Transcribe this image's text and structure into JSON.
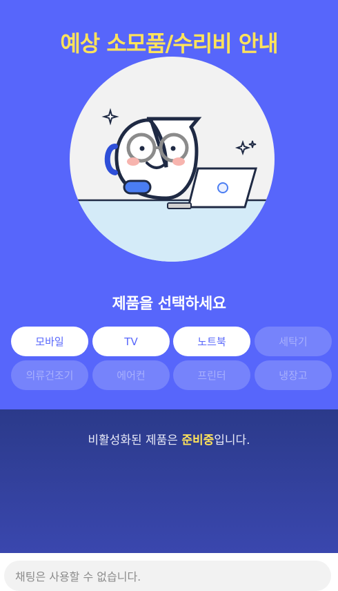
{
  "header": {
    "title": "예상 소모품/수리비 안내"
  },
  "main": {
    "subtitle": "제품을 선택하세요",
    "products": [
      {
        "label": "모바일",
        "enabled": true
      },
      {
        "label": "TV",
        "enabled": true
      },
      {
        "label": "노트북",
        "enabled": true
      },
      {
        "label": "세탁기",
        "enabled": false
      },
      {
        "label": "의류건조기",
        "enabled": false
      },
      {
        "label": "에어컨",
        "enabled": false
      },
      {
        "label": "프린터",
        "enabled": false
      },
      {
        "label": "냉장고",
        "enabled": false
      }
    ]
  },
  "notice": {
    "prefix": "비활성화된 제품은 ",
    "highlight": "준비중",
    "suffix": "입니다."
  },
  "chat": {
    "placeholder": "채팅은 사용할 수 없습니다."
  },
  "colors": {
    "primary": "#5766fb",
    "accent": "#ffe35a",
    "chip_disabled": "#7683fb",
    "bottom_panel": "#2b3a8a"
  }
}
